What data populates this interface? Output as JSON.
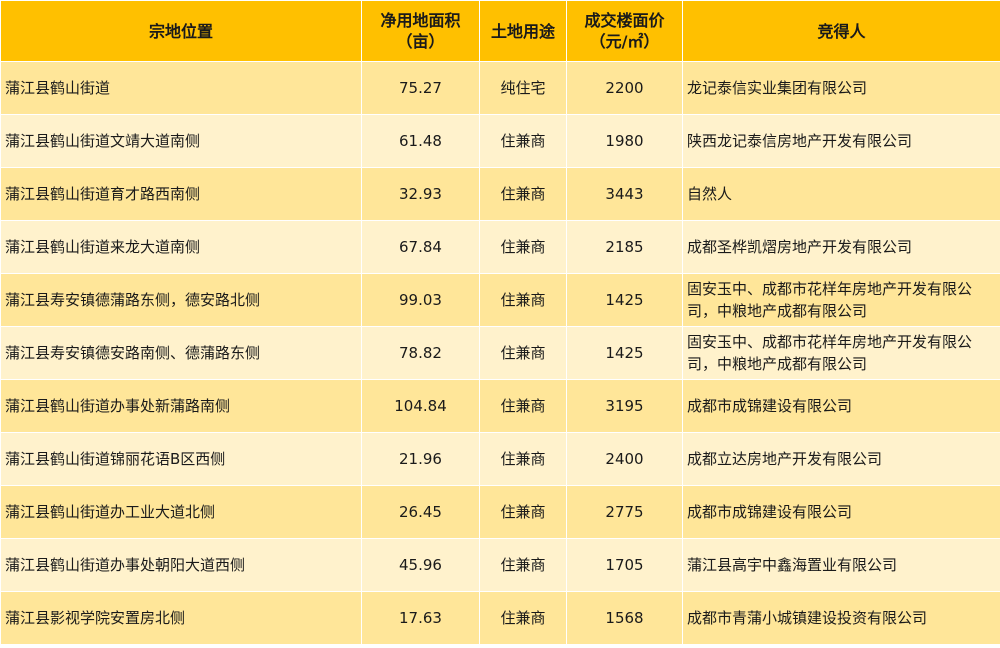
{
  "headers": {
    "location": "宗地位置",
    "area_line1": "净用地面积",
    "area_line2": "（亩）",
    "use": "土地用途",
    "price_line1": "成交楼面价",
    "price_line2": "（元/㎡）",
    "winner": "竞得人"
  },
  "rows": [
    {
      "location": "蒲江县鹤山街道",
      "area": "75.27",
      "use": "纯住宅",
      "price": "2200",
      "winner": "龙记泰信实业集团有限公司"
    },
    {
      "location": "蒲江县鹤山街道文靖大道南侧",
      "area": "61.48",
      "use": "住兼商",
      "price": "1980",
      "winner": "陕西龙记泰信房地产开发有限公司"
    },
    {
      "location": "蒲江县鹤山街道育才路西南侧",
      "area": "32.93",
      "use": "住兼商",
      "price": "3443",
      "winner": "自然人"
    },
    {
      "location": "蒲江县鹤山街道来龙大道南侧",
      "area": "67.84",
      "use": "住兼商",
      "price": "2185",
      "winner": "成都圣桦凯熠房地产开发有限公司"
    },
    {
      "location": "蒲江县寿安镇德蒲路东侧，德安路北侧",
      "area": "99.03",
      "use": "住兼商",
      "price": "1425",
      "winner": "固安玉中、成都市花样年房地产开发有限公司，中粮地产成都有限公司"
    },
    {
      "location": "蒲江县寿安镇德安路南侧、德蒲路东侧",
      "area": "78.82",
      "use": "住兼商",
      "price": "1425",
      "winner": "固安玉中、成都市花样年房地产开发有限公司，中粮地产成都有限公司"
    },
    {
      "location": "蒲江县鹤山街道办事处新蒲路南侧",
      "area": "104.84",
      "use": "住兼商",
      "price": "3195",
      "winner": "成都市成锦建设有限公司"
    },
    {
      "location": "蒲江县鹤山街道锦丽花语B区西侧",
      "area": "21.96",
      "use": "住兼商",
      "price": "2400",
      "winner": "成都立达房地产开发有限公司"
    },
    {
      "location": "蒲江县鹤山街道办工业大道北侧",
      "area": "26.45",
      "use": "住兼商",
      "price": "2775",
      "winner": "成都市成锦建设有限公司"
    },
    {
      "location": "蒲江县鹤山街道办事处朝阳大道西侧",
      "area": "45.96",
      "use": "住兼商",
      "price": "1705",
      "winner": "蒲江县高宇中鑫海置业有限公司"
    },
    {
      "location": "蒲江县影视学院安置房北侧",
      "area": "17.63",
      "use": "住兼商",
      "price": "1568",
      "winner": "成都市青蒲小城镇建设投资有限公司"
    }
  ],
  "colors": {
    "header": "#ffc000",
    "row_odd": "#ffe699",
    "row_even": "#fff2cc"
  }
}
